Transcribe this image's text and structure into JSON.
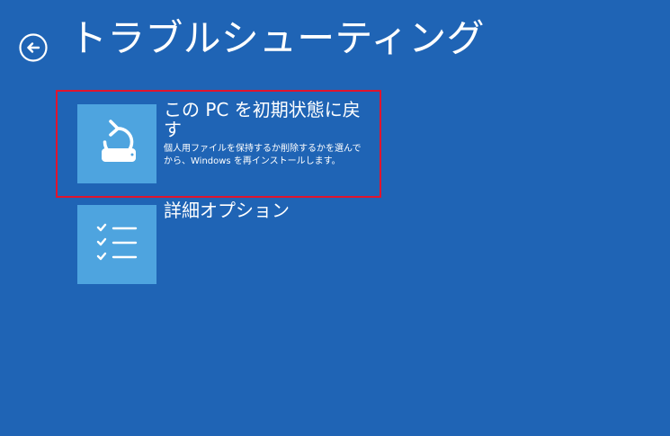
{
  "header": {
    "title": "トラブルシューティング",
    "back_icon": "back-arrow-icon"
  },
  "options": [
    {
      "title": "この PC を初期状態に戻す",
      "description": "個人用ファイルを保持するか削除するかを選んでから、Windows を再インストールします。",
      "icon": "reset-pc-icon",
      "highlighted": true
    },
    {
      "title": "詳細オプション",
      "description": "",
      "icon": "checklist-icon",
      "highlighted": false
    }
  ],
  "colors": {
    "background": "#1f64b5",
    "tile": "#4ea4df",
    "highlight": "#e1142d",
    "text": "#ffffff"
  }
}
